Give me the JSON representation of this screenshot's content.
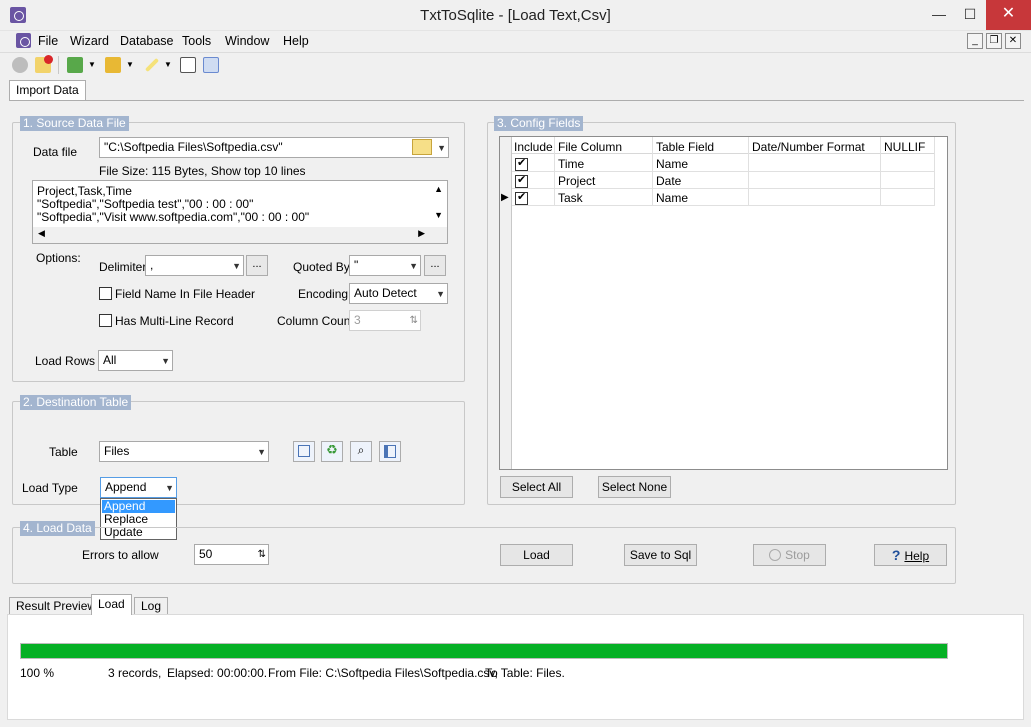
{
  "window": {
    "title": "TxtToSqlite - [Load Text,Csv]"
  },
  "menu": [
    "File",
    "Wizard",
    "Database",
    "Tools",
    "Window",
    "Help"
  ],
  "main_tab": "Import Data",
  "source": {
    "group_title": "1. Source Data File",
    "data_file_label": "Data file",
    "data_file_value": "\"C:\\Softpedia Files\\Softpedia.csv\"",
    "file_info": "File Size: 115 Bytes,  Show top 10 lines",
    "preview_lines": [
      "Project,Task,Time",
      "\"Softpedia\",\"Softpedia test\",\"00 : 00 : 00\"",
      "\"Softpedia\",\"Visit www.softpedia.com\",\"00 : 00 : 00\""
    ],
    "options_label": "Options:",
    "delimiter_label": "Delimiter",
    "delimiter_value": ",",
    "quoted_by_label": "Quoted By",
    "quoted_by_value": "\"",
    "field_name_header_label": "Field Name In File Header",
    "field_name_header_checked": false,
    "encoding_label": "Encoding",
    "encoding_value": "Auto Detect",
    "multiline_label": "Has Multi-Line Record",
    "multiline_checked": false,
    "column_count_label": "Column Count",
    "column_count_value": "3",
    "load_rows_label": "Load Rows",
    "load_rows_value": "All",
    "ellipsis": "..."
  },
  "destination": {
    "group_title": "2. Destination Table",
    "table_label": "Table",
    "table_value": "Files",
    "load_type_label": "Load Type",
    "load_type_value": "Append",
    "load_type_options": [
      "Append",
      "Replace",
      "Update"
    ]
  },
  "config": {
    "group_title": "3. Config Fields",
    "columns": [
      "Include",
      "File Column",
      "Table Field",
      "Date/Number Format",
      "NULLIF"
    ],
    "rows": [
      {
        "include": true,
        "file_column": "Time",
        "table_field": "Name"
      },
      {
        "include": true,
        "file_column": "Project",
        "table_field": "Date"
      },
      {
        "include": true,
        "file_column": "Task",
        "table_field": "Name"
      }
    ],
    "select_all_label": "Select All",
    "select_none_label": "Select None"
  },
  "load_data": {
    "group_title": "4. Load Data",
    "errors_label": "Errors to allow",
    "errors_value": "50",
    "load_button": "Load",
    "save_sql_button": "Save to Sql",
    "stop_button": "Stop",
    "help_button": "Help"
  },
  "bottom_tabs": [
    "Result Preview",
    "Load",
    "Log"
  ],
  "status": {
    "progress": 1.0,
    "percent_text": "100 %",
    "records_text": "3 records,",
    "elapsed_text": "Elapsed: 00:00:00.",
    "from_text": "From File: C:\\Softpedia Files\\Softpedia.csv,",
    "to_text": "To Table: Files."
  },
  "colors": {
    "progress": "#06b025",
    "group_title_bg": "#a3b5cf",
    "close_button": "#c7373a",
    "selection": "#3399ff"
  }
}
